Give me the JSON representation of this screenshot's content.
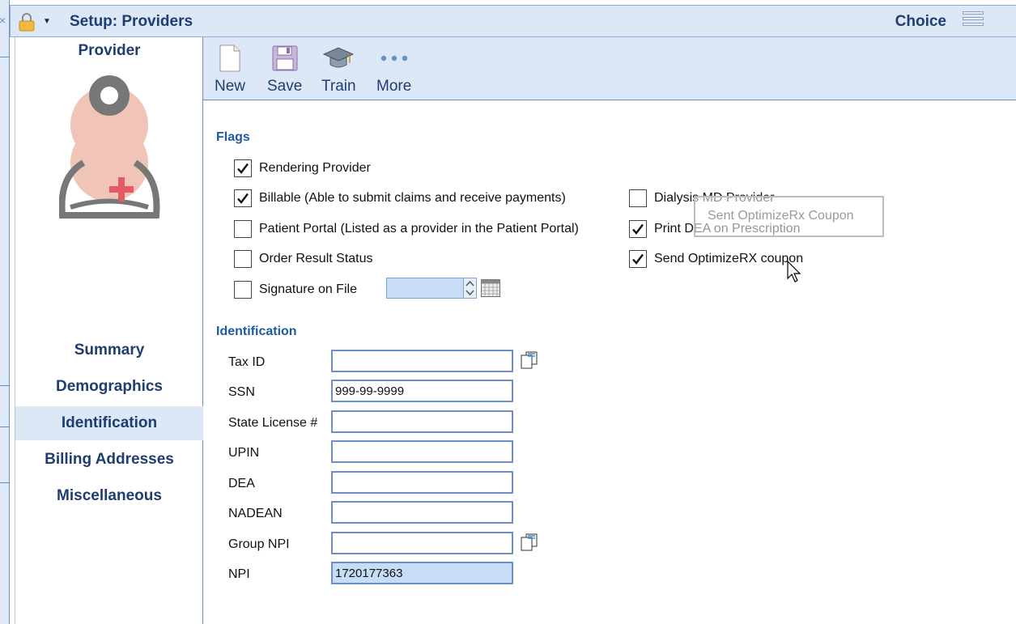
{
  "header": {
    "title": "Setup: Providers",
    "choice": "Choice"
  },
  "sidebar": {
    "title": "Provider",
    "nav": [
      "Summary",
      "Demographics",
      "Identification",
      "Billing Addresses",
      "Miscellaneous"
    ],
    "active": "Identification"
  },
  "toolbar": {
    "new": "New",
    "save": "Save",
    "train": "Train",
    "more": "More"
  },
  "flags": {
    "title": "Flags",
    "rendering": {
      "label": "Rendering Provider",
      "checked": true
    },
    "billable": {
      "label": "Billable (Able to submit claims and receive payments)",
      "checked": true
    },
    "patient_portal": {
      "label": "Patient Portal (Listed as a provider in the Patient Portal)",
      "checked": false
    },
    "order_result": {
      "label": "Order Result Status",
      "checked": false
    },
    "signature": {
      "label": "Signature on File",
      "checked": false
    },
    "dialysis": {
      "label": "Dialysis MD Provider",
      "checked": false
    },
    "print_dea": {
      "label": "Print DEA on Prescription",
      "checked": true
    },
    "optimizerx": {
      "label": "Send OptimizeRX coupon",
      "checked": true
    }
  },
  "identification": {
    "title": "Identification",
    "tax_id": {
      "label": "Tax ID",
      "value": ""
    },
    "ssn": {
      "label": "SSN",
      "value": "999-99-9999"
    },
    "state_license": {
      "label": "State License #",
      "value": ""
    },
    "upin": {
      "label": "UPIN",
      "value": ""
    },
    "dea": {
      "label": "DEA",
      "value": ""
    },
    "nadean": {
      "label": "NADEAN",
      "value": ""
    },
    "group_npi": {
      "label": "Group NPI",
      "value": ""
    },
    "npi": {
      "label": "NPI",
      "value": "1720177363"
    }
  },
  "tooltip": "Sent OptimizeRx Coupon",
  "colors": {
    "accent": "#1f3d6e",
    "header_bg": "#dde8f7",
    "border": "#6d8fc8",
    "highlight": "#c6dcf7"
  }
}
